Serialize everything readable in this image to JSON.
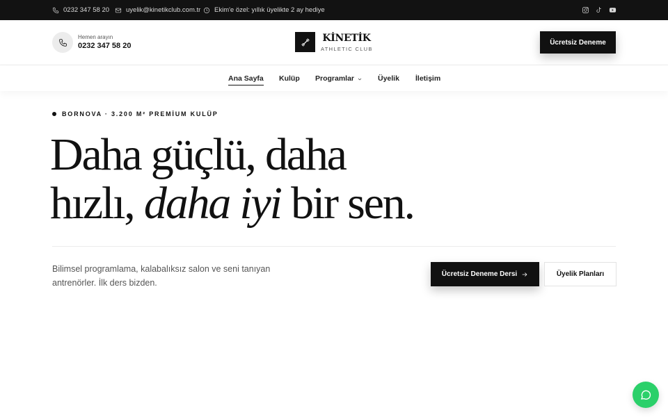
{
  "topbar": {
    "phone": "0232 347 58 20",
    "email": "uyelik@kinetikclub.com.tr",
    "promo": "Ekim'e özel: yıllık üyelikte 2 ay hediye",
    "socials": [
      "instagram-icon",
      "tiktok-icon",
      "youtube-icon"
    ]
  },
  "header": {
    "call_label": "Hemen arayın",
    "call_number": "0232 347 58 20",
    "logo_name": "KİNETİK",
    "logo_sub": "ATHLETIC CLUB",
    "cta": "Ücretsiz Deneme"
  },
  "nav": {
    "items": [
      {
        "label": "Ana Sayfa",
        "active": true
      },
      {
        "label": "Kulüp"
      },
      {
        "label": "Programlar",
        "has_dropdown": true
      },
      {
        "label": "Üyelik"
      },
      {
        "label": "İletişim"
      }
    ]
  },
  "hero": {
    "eyebrow": "BORNOVA · 3.200 M² PREMİUM KULÜP",
    "headline_line1": "Daha güçlü, daha",
    "headline_line2_start": "hızlı,",
    "headline_line2_italic": "daha iyi",
    "headline_line2_end": "bir sen.",
    "lead": "Bilimsel programlama, kalabalıksız salon ve seni tanıyan antrenörler. İlk ders bizden.",
    "primary_cta": "Ücretsiz Deneme Dersi",
    "secondary_cta": "Üyelik Planları"
  },
  "colors": {
    "dark": "#121212",
    "chat_green": "#2bd06a"
  }
}
